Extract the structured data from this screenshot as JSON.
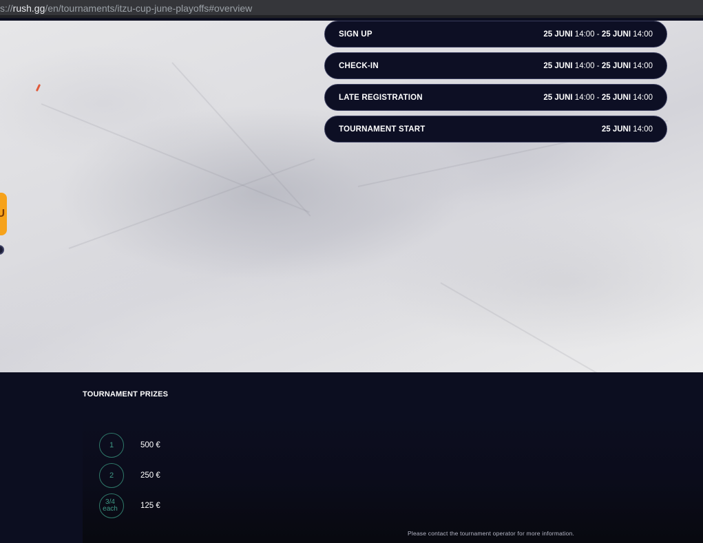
{
  "browser": {
    "url_prefix": "s://",
    "url_host": "rush.gg",
    "url_path": "/en/tournaments/itzu-cup-june-playoffs#overview"
  },
  "schedule": [
    {
      "label": "SIGN UP",
      "start_date": "25 JUNI",
      "start_time": "14:00",
      "sep": "-",
      "end_date": "25 JUNI",
      "end_time": "14:00"
    },
    {
      "label": "CHECK-IN",
      "start_date": "25 JUNI",
      "start_time": "14:00",
      "sep": "-",
      "end_date": "25 JUNI",
      "end_time": "14:00"
    },
    {
      "label": "LATE REGISTRATION",
      "start_date": "25 JUNI",
      "start_time": "14:00",
      "sep": "-",
      "end_date": "25 JUNI",
      "end_time": "14:00"
    },
    {
      "label": "TOURNAMENT START",
      "start_date": "25 JUNI",
      "start_time": "14:00"
    }
  ],
  "prizes": {
    "title": "TOURNAMENT PRIZES",
    "items": [
      {
        "place": "1",
        "amount": "500 €"
      },
      {
        "place": "2",
        "amount": "250 €"
      },
      {
        "place": "3/4 each",
        "amount": "125 €"
      }
    ],
    "note": "Please contact the tournament operator for more information."
  },
  "colors": {
    "pill_bg": "#0d0f24",
    "section_bg": "#0c0e20",
    "place_ring": "#2f7a6a",
    "side_badge": "#f6a21b"
  }
}
